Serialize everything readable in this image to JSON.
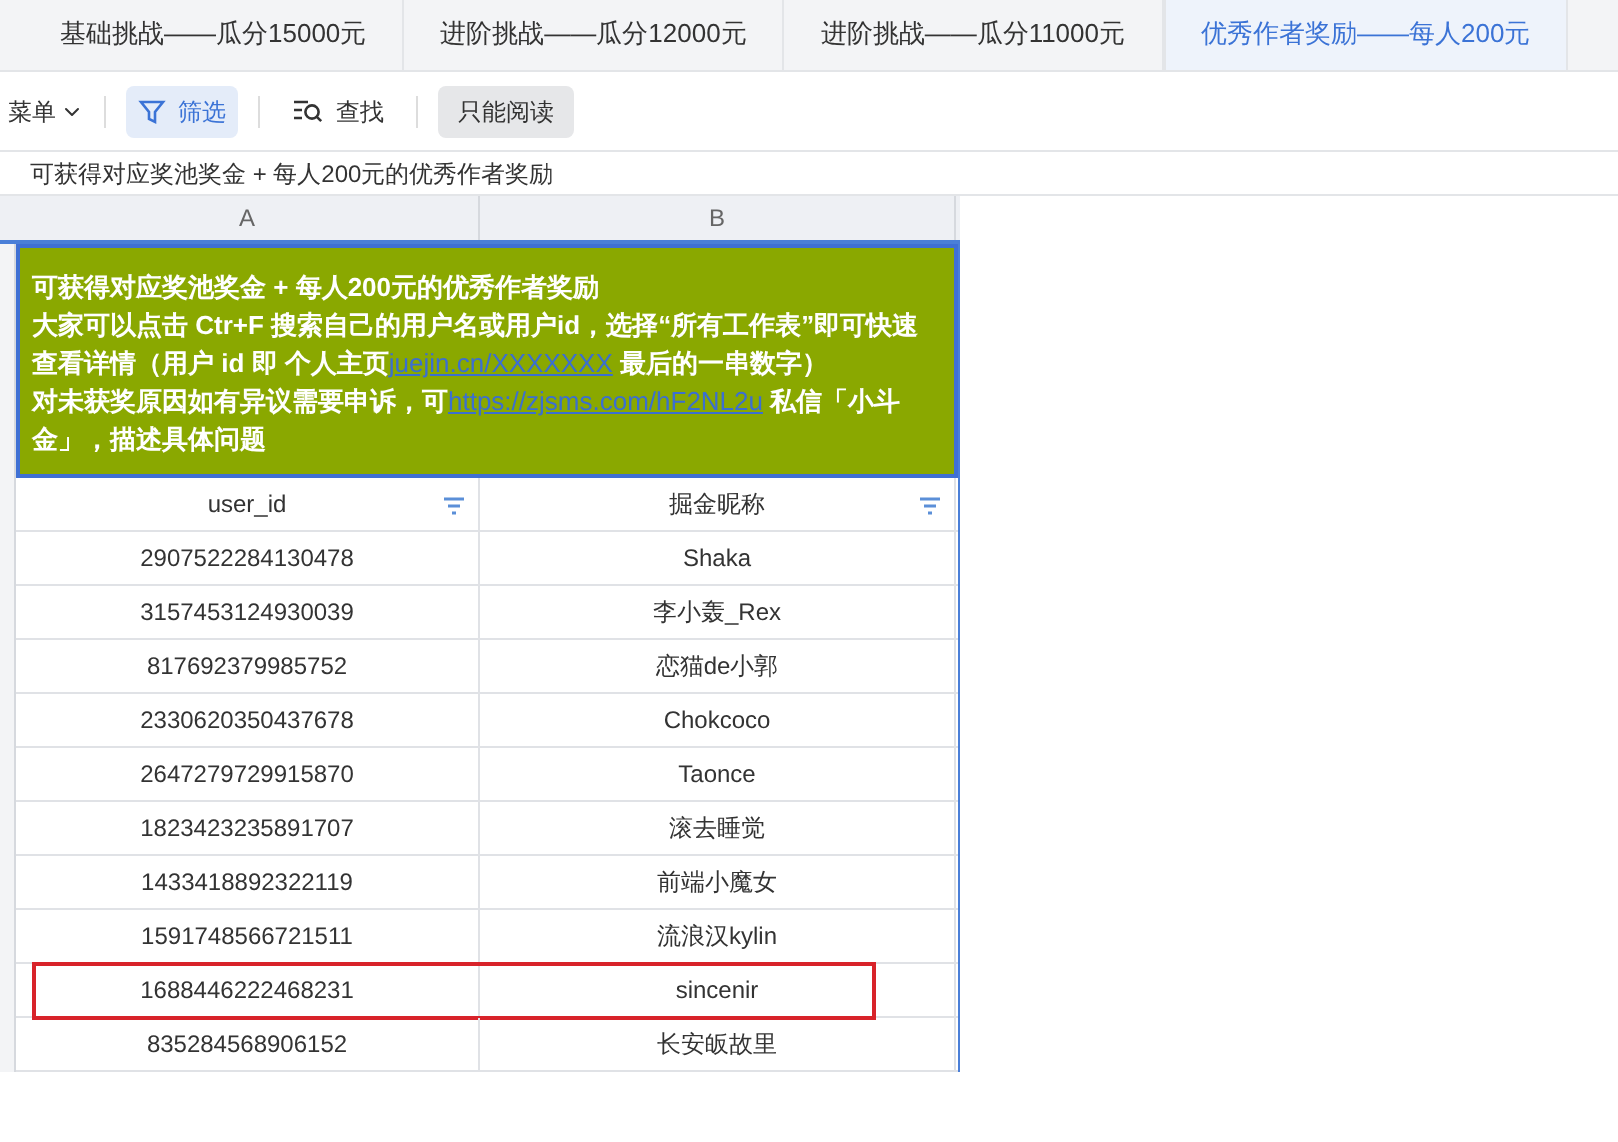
{
  "tabs": [
    {
      "label": "基础挑战——瓜分15000元",
      "selected": false
    },
    {
      "label": "进阶挑战——瓜分12000元",
      "selected": false
    },
    {
      "label": "进阶挑战——瓜分11000元",
      "selected": false
    },
    {
      "label": "优秀作者奖励——每人200元",
      "selected": true
    }
  ],
  "toolbar": {
    "menu": "菜单",
    "filter": {
      "label": "筛选",
      "selected": true
    },
    "find": "查找",
    "readonly": "只能阅读"
  },
  "formula_bar": "可获得对应奖池奖金 + 每人200元的优秀作者奖励",
  "columns": [
    "A",
    "B"
  ],
  "notice": [
    [
      {
        "kind": "text",
        "text": "可获得对应奖池奖金 + 每人200元的优秀作者奖励"
      }
    ],
    [
      {
        "kind": "text",
        "text": "大家可以点击 Ctr+F 搜索自己的用户名或用户id，选择“所有工作表”即可快速查看详情（用户 id 即 个人主页"
      },
      {
        "kind": "link",
        "text": "juejin.cn/XXXXXXX"
      },
      {
        "kind": "text",
        "text": " 最后的一串数字）"
      }
    ],
    [
      {
        "kind": "text",
        "text": "对未获奖原因如有异议需要申诉，可"
      },
      {
        "kind": "link",
        "text": "https://zjsms.com/hF2NL2u"
      },
      {
        "kind": "text",
        "text": " 私信「小斗金」，描述具体问题"
      }
    ]
  ],
  "table": {
    "headers": [
      "user_id",
      "掘金昵称"
    ],
    "rows": [
      {
        "cells": [
          "2907522284130478",
          "Shaka"
        ],
        "highlighted": false
      },
      {
        "cells": [
          "3157453124930039",
          "李小轰_Rex"
        ],
        "highlighted": false
      },
      {
        "cells": [
          "817692379985752",
          "恋猫de小郭"
        ],
        "highlighted": false
      },
      {
        "cells": [
          "2330620350437678",
          "Chokcoco"
        ],
        "highlighted": false
      },
      {
        "cells": [
          "2647279729915870",
          "Taonce"
        ],
        "highlighted": false
      },
      {
        "cells": [
          "1823423235891707",
          "滚去睡觉"
        ],
        "highlighted": false
      },
      {
        "cells": [
          "1433418892322119",
          "前端小魔女"
        ],
        "highlighted": false
      },
      {
        "cells": [
          "1591748566721511",
          "流浪汉kylin"
        ],
        "highlighted": false
      },
      {
        "cells": [
          "1688446222468231",
          "sincenir"
        ],
        "highlighted": true
      },
      {
        "cells": [
          "835284568906152",
          "长安皈故里"
        ],
        "highlighted": false
      }
    ]
  }
}
